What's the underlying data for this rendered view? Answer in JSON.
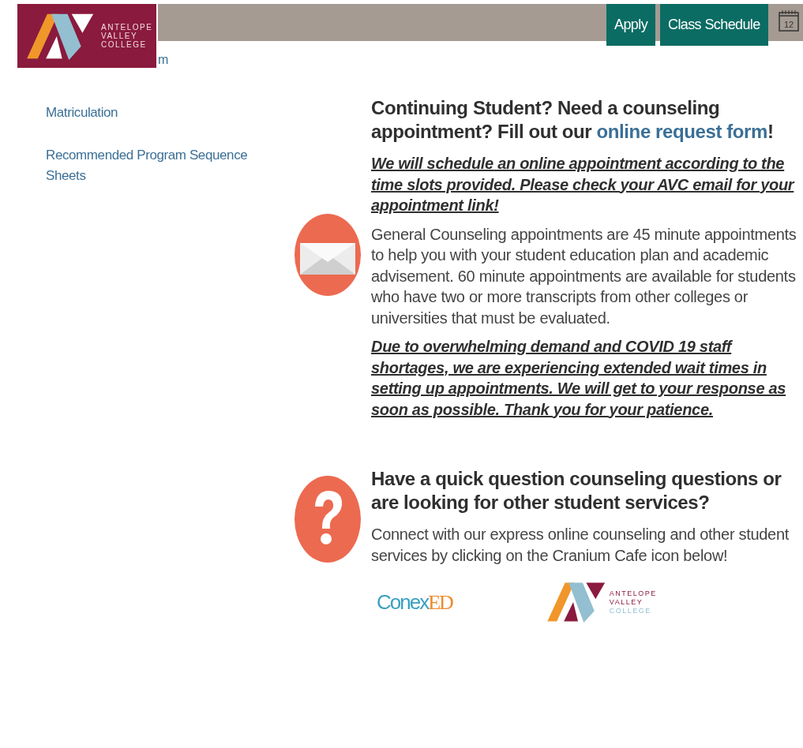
{
  "header": {
    "logo": {
      "lines": [
        "ANTELOPE",
        "VALLEY",
        "COLLEGE"
      ]
    },
    "buttons": [
      "Apply",
      "Class Schedule"
    ],
    "calendar_day": "12"
  },
  "partial_link": "m",
  "sidebar": {
    "items": [
      "Matriculation",
      "Recommended Program Sequence Sheets"
    ]
  },
  "sections": [
    {
      "kind": "mail",
      "heading": {
        "before": "Continuing Student? Need a counseling appointment? Fill out our ",
        "link": "online request form",
        "after": "!"
      },
      "paragraphs": [
        {
          "kind": "emphasis",
          "text": "We will schedule an online appointment according to the time slots provided. Please check your AVC email for your appointment link!"
        },
        {
          "kind": "plain",
          "text": "General Counseling appointments are 45 minute appointments to help you with your student education plan and academic advisement. 60 minute appointments are available for students who have two or more transcripts from other colleges or universities that must be evaluated."
        },
        {
          "kind": "emphasis",
          "text": "Due to overwhelming demand and COVID 19 staff shortages, we are experiencing extended wait times in setting up appointments. We will get to your response as soon as possible. Thank you for your patience."
        }
      ]
    },
    {
      "kind": "question",
      "heading": {
        "before": "Have a quick question counseling questions or are looking for other student services?"
      },
      "paragraphs": [
        {
          "kind": "plain",
          "text": "Connect with our express online counseling and other student services by clicking on the Cranium Cafe icon below!"
        }
      ]
    }
  ],
  "partner_logos": [
    {
      "kind": "conexed",
      "parts": [
        "Conex",
        "ED"
      ]
    },
    {
      "kind": "avc",
      "lines": [
        "ANTELOPE",
        "VALLEY",
        "COLLEGE"
      ]
    }
  ]
}
